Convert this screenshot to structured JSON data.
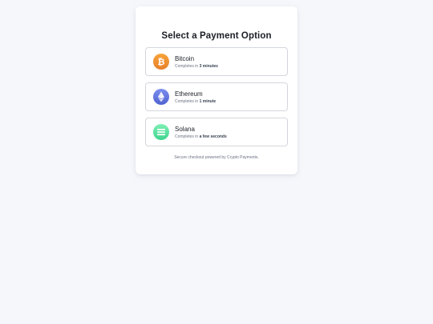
{
  "title": "Select a Payment Option",
  "options": [
    {
      "name": "Bitcoin",
      "completes_prefix": "Completes in ",
      "completes_time": "3 minutes",
      "icon": "bitcoin-icon",
      "color_top": "#f7a43a",
      "color_bottom": "#e8802a"
    },
    {
      "name": "Ethereum",
      "completes_prefix": "Completes in ",
      "completes_time": "1 minute",
      "icon": "ethereum-icon",
      "color_top": "#7b8ff0",
      "color_bottom": "#4f62cf"
    },
    {
      "name": "Solana",
      "completes_prefix": "Completes in ",
      "completes_time": "a few seconds",
      "icon": "solana-icon",
      "color_top": "#7ff0b4",
      "color_bottom": "#3ed38f"
    }
  ],
  "footer": "Secure checkout powered by Crypto Payments."
}
